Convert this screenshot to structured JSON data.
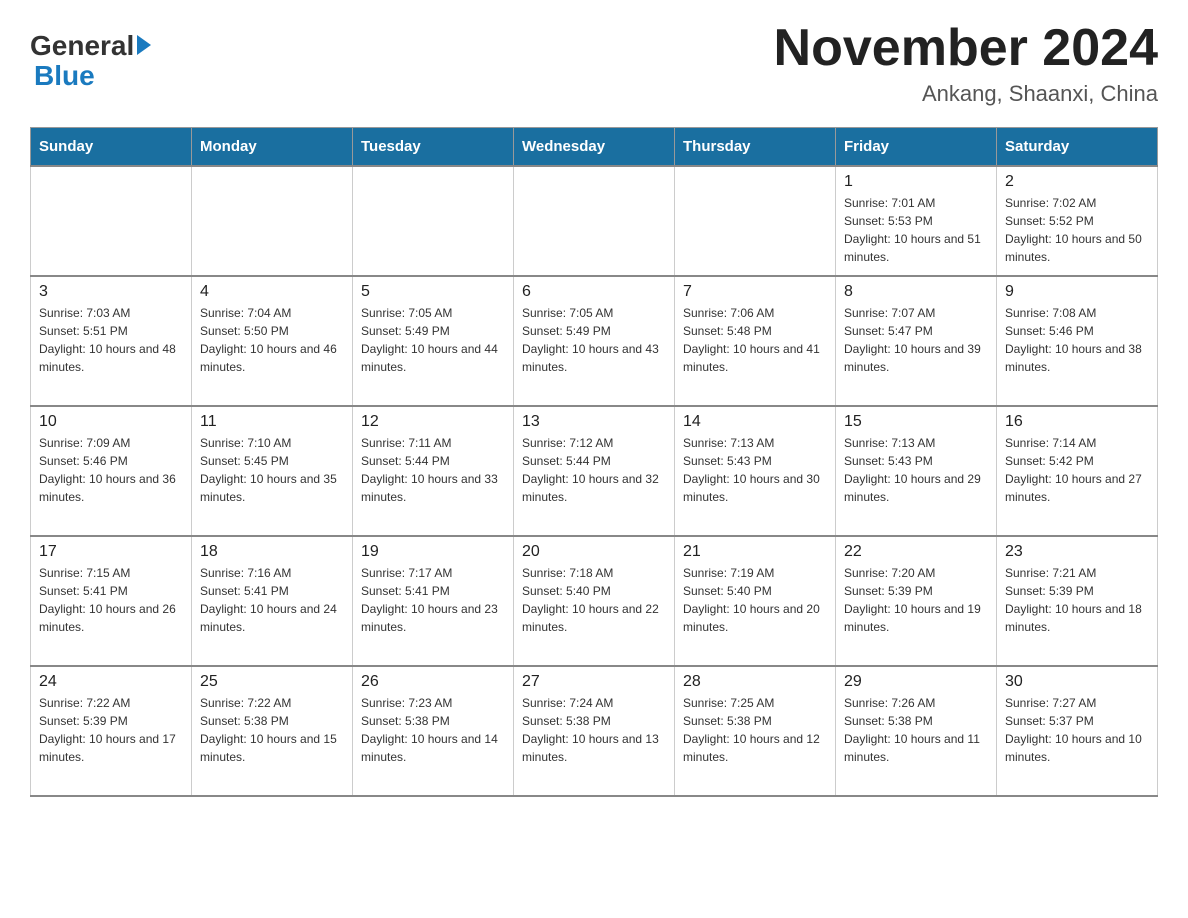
{
  "header": {
    "logo_general": "General",
    "logo_blue": "Blue",
    "title": "November 2024",
    "subtitle": "Ankang, Shaanxi, China"
  },
  "weekdays": [
    "Sunday",
    "Monday",
    "Tuesday",
    "Wednesday",
    "Thursday",
    "Friday",
    "Saturday"
  ],
  "weeks": [
    [
      {
        "day": "",
        "info": ""
      },
      {
        "day": "",
        "info": ""
      },
      {
        "day": "",
        "info": ""
      },
      {
        "day": "",
        "info": ""
      },
      {
        "day": "",
        "info": ""
      },
      {
        "day": "1",
        "info": "Sunrise: 7:01 AM\nSunset: 5:53 PM\nDaylight: 10 hours and 51 minutes."
      },
      {
        "day": "2",
        "info": "Sunrise: 7:02 AM\nSunset: 5:52 PM\nDaylight: 10 hours and 50 minutes."
      }
    ],
    [
      {
        "day": "3",
        "info": "Sunrise: 7:03 AM\nSunset: 5:51 PM\nDaylight: 10 hours and 48 minutes."
      },
      {
        "day": "4",
        "info": "Sunrise: 7:04 AM\nSunset: 5:50 PM\nDaylight: 10 hours and 46 minutes."
      },
      {
        "day": "5",
        "info": "Sunrise: 7:05 AM\nSunset: 5:49 PM\nDaylight: 10 hours and 44 minutes."
      },
      {
        "day": "6",
        "info": "Sunrise: 7:05 AM\nSunset: 5:49 PM\nDaylight: 10 hours and 43 minutes."
      },
      {
        "day": "7",
        "info": "Sunrise: 7:06 AM\nSunset: 5:48 PM\nDaylight: 10 hours and 41 minutes."
      },
      {
        "day": "8",
        "info": "Sunrise: 7:07 AM\nSunset: 5:47 PM\nDaylight: 10 hours and 39 minutes."
      },
      {
        "day": "9",
        "info": "Sunrise: 7:08 AM\nSunset: 5:46 PM\nDaylight: 10 hours and 38 minutes."
      }
    ],
    [
      {
        "day": "10",
        "info": "Sunrise: 7:09 AM\nSunset: 5:46 PM\nDaylight: 10 hours and 36 minutes."
      },
      {
        "day": "11",
        "info": "Sunrise: 7:10 AM\nSunset: 5:45 PM\nDaylight: 10 hours and 35 minutes."
      },
      {
        "day": "12",
        "info": "Sunrise: 7:11 AM\nSunset: 5:44 PM\nDaylight: 10 hours and 33 minutes."
      },
      {
        "day": "13",
        "info": "Sunrise: 7:12 AM\nSunset: 5:44 PM\nDaylight: 10 hours and 32 minutes."
      },
      {
        "day": "14",
        "info": "Sunrise: 7:13 AM\nSunset: 5:43 PM\nDaylight: 10 hours and 30 minutes."
      },
      {
        "day": "15",
        "info": "Sunrise: 7:13 AM\nSunset: 5:43 PM\nDaylight: 10 hours and 29 minutes."
      },
      {
        "day": "16",
        "info": "Sunrise: 7:14 AM\nSunset: 5:42 PM\nDaylight: 10 hours and 27 minutes."
      }
    ],
    [
      {
        "day": "17",
        "info": "Sunrise: 7:15 AM\nSunset: 5:41 PM\nDaylight: 10 hours and 26 minutes."
      },
      {
        "day": "18",
        "info": "Sunrise: 7:16 AM\nSunset: 5:41 PM\nDaylight: 10 hours and 24 minutes."
      },
      {
        "day": "19",
        "info": "Sunrise: 7:17 AM\nSunset: 5:41 PM\nDaylight: 10 hours and 23 minutes."
      },
      {
        "day": "20",
        "info": "Sunrise: 7:18 AM\nSunset: 5:40 PM\nDaylight: 10 hours and 22 minutes."
      },
      {
        "day": "21",
        "info": "Sunrise: 7:19 AM\nSunset: 5:40 PM\nDaylight: 10 hours and 20 minutes."
      },
      {
        "day": "22",
        "info": "Sunrise: 7:20 AM\nSunset: 5:39 PM\nDaylight: 10 hours and 19 minutes."
      },
      {
        "day": "23",
        "info": "Sunrise: 7:21 AM\nSunset: 5:39 PM\nDaylight: 10 hours and 18 minutes."
      }
    ],
    [
      {
        "day": "24",
        "info": "Sunrise: 7:22 AM\nSunset: 5:39 PM\nDaylight: 10 hours and 17 minutes."
      },
      {
        "day": "25",
        "info": "Sunrise: 7:22 AM\nSunset: 5:38 PM\nDaylight: 10 hours and 15 minutes."
      },
      {
        "day": "26",
        "info": "Sunrise: 7:23 AM\nSunset: 5:38 PM\nDaylight: 10 hours and 14 minutes."
      },
      {
        "day": "27",
        "info": "Sunrise: 7:24 AM\nSunset: 5:38 PM\nDaylight: 10 hours and 13 minutes."
      },
      {
        "day": "28",
        "info": "Sunrise: 7:25 AM\nSunset: 5:38 PM\nDaylight: 10 hours and 12 minutes."
      },
      {
        "day": "29",
        "info": "Sunrise: 7:26 AM\nSunset: 5:38 PM\nDaylight: 10 hours and 11 minutes."
      },
      {
        "day": "30",
        "info": "Sunrise: 7:27 AM\nSunset: 5:37 PM\nDaylight: 10 hours and 10 minutes."
      }
    ]
  ]
}
